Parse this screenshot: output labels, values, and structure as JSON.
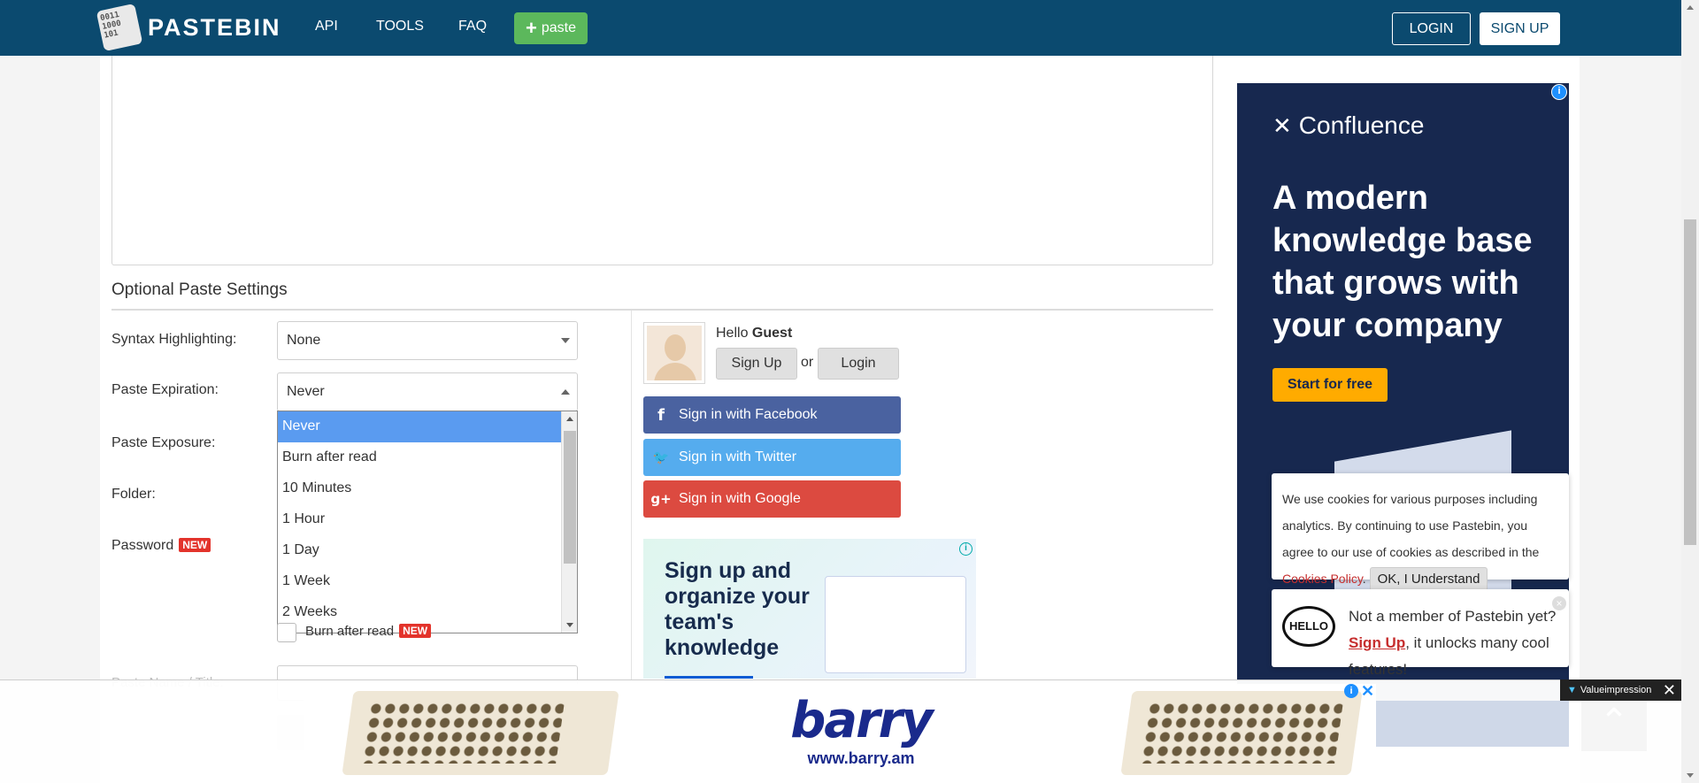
{
  "header": {
    "logo_text": "PASTEBIN",
    "logo_icon_text": "0011\n1000\n101",
    "nav": [
      "API",
      "TOOLS",
      "FAQ"
    ],
    "paste_button": "paste",
    "login": "LOGIN",
    "signup": "SIGN UP",
    "colors": {
      "bar": "#0b4a6f",
      "paste_button": "#5cb85c"
    }
  },
  "settings": {
    "title": "Optional Paste Settings",
    "labels": {
      "syntax": "Syntax Highlighting:",
      "expiration": "Paste Expiration:",
      "exposure": "Paste Exposure:",
      "folder": "Folder:",
      "password": "Password",
      "name_title": "Paste Name / Title:"
    },
    "new_badge": "NEW",
    "syntax_value": "None",
    "expiration_value": "Never",
    "expiration_options": [
      "Never",
      "Burn after read",
      "10 Minutes",
      "1 Hour",
      "1 Day",
      "1 Week",
      "2 Weeks"
    ],
    "expiration_selected_index": 0,
    "burn_label": "Burn after read"
  },
  "guest": {
    "hello": "Hello",
    "name": "Guest",
    "signup": "Sign Up",
    "or": "or",
    "login": "Login",
    "facebook": "Sign in with Facebook",
    "twitter": "Sign in with Twitter",
    "google": "Sign in with Google",
    "facebook_icon": "f",
    "twitter_icon": "🐦",
    "google_icon": "g+"
  },
  "small_ad": {
    "text": "Sign up and organize your team's knowledge",
    "info": "i"
  },
  "right_ad": {
    "brand": "Confluence",
    "headline": "A modern knowledge base that grows with your company",
    "cta": "Start for free",
    "info": "i",
    "colors": {
      "bg": "#17284f",
      "cta": "#ffab00"
    }
  },
  "cookie": {
    "text_before": "We use cookies for various purposes including analytics. By continuing to use Pastebin, you agree to our use of cookies as described in the ",
    "link": "Cookies Policy",
    "text_after": ".",
    "ok": "OK, I Understand"
  },
  "member": {
    "bubble": "HELLO",
    "line1": "Not a member of Pastebin yet?",
    "link": "Sign Up",
    "line2": ", it unlocks many cool features!",
    "close": "×"
  },
  "bottom_banner": {
    "brand": "barry",
    "url": "www.barry.am",
    "info": "i",
    "close": "✕",
    "vi_label": "Valueimpression",
    "vi_close": "✕"
  }
}
